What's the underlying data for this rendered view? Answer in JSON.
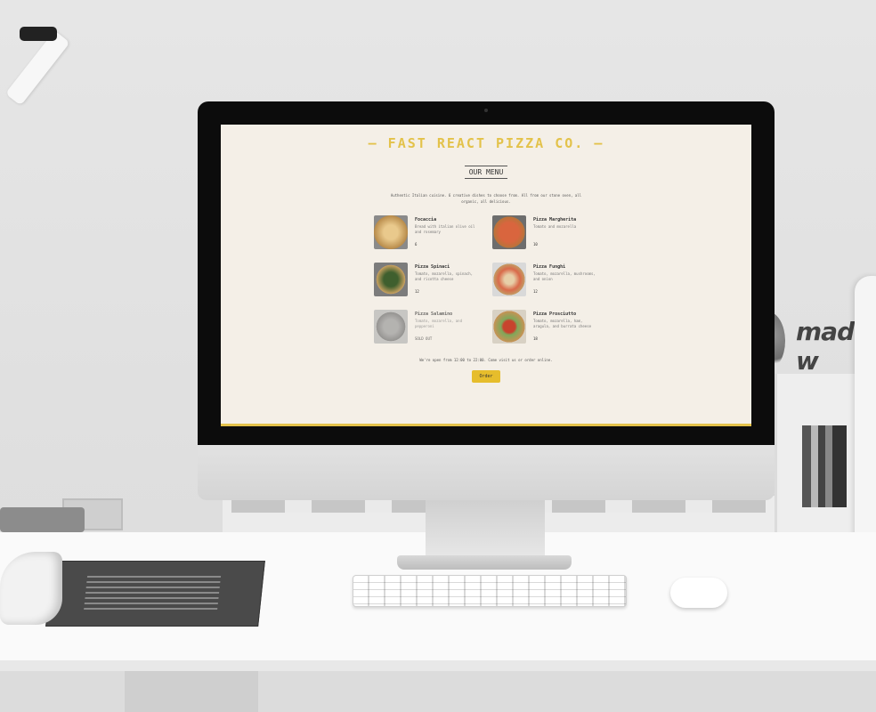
{
  "website": {
    "brand": "— FAST REACT PIZZA CO. —",
    "menu_title": "OUR MENU",
    "intro": "Authentic Italian cuisine. 6 creative dishes to choose from. All from our stone oven, all organic, all delicious.",
    "pizzas": [
      {
        "name": "Focaccia",
        "ingredients": "Bread with italian olive oil and rosemary",
        "price": "6"
      },
      {
        "name": "Pizza Margherita",
        "ingredients": "Tomato and mozarella",
        "price": "10"
      },
      {
        "name": "Pizza Spinaci",
        "ingredients": "Tomato, mozarella, spinach, and ricotta cheese",
        "price": "12"
      },
      {
        "name": "Pizza Funghi",
        "ingredients": "Tomato, mozarella, mushrooms, and onion",
        "price": "12"
      },
      {
        "name": "Pizza Salamino",
        "ingredients": "Tomato, mozarella, and pepperoni",
        "price": "SOLD OUT"
      },
      {
        "name": "Pizza Prosciutto",
        "ingredients": "Tomato, mozarella, ham, aragula, and burrata cheese",
        "price": "18"
      }
    ],
    "footer_text": "We're open from 12:00 to 22:00. Come visit us or order online.",
    "order_button": "Order"
  },
  "backdrop": {
    "logo_text": "made w"
  },
  "colors": {
    "brand_yellow": "#e3c24a",
    "button_yellow": "#e6bd2c",
    "screen_bg": "#f4efe7"
  }
}
